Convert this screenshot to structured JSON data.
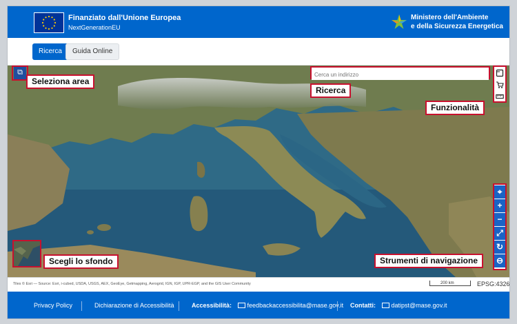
{
  "header": {
    "title": "Finanziato dall'Unione Europea",
    "subtitle": "NextGenerationEU",
    "ministry_line1": "Ministero dell'Ambiente",
    "ministry_line2": "e della Sicurezza Energetica"
  },
  "tabs": [
    {
      "label": "Ricerca",
      "active": true
    },
    {
      "label": "Guida Online",
      "active": false
    }
  ],
  "map": {
    "search_placeholder": "Cerca un indirizzo",
    "annotations": {
      "select_area": "Seleziona area",
      "search": "Ricerca",
      "functions": "Funzionalità",
      "background": "Scegli lo sfondo",
      "navigation": "Strumenti di navigazione"
    },
    "attribution": "Tiles © Esri — Source: Esri, i-cubed, USDA, USGS, AEX, GeoEye, Getmapping, Aerogrid, IGN, IGP, UPR-EGP, and the GIS User Community",
    "scale_label": "200 km",
    "projection": "EPSG:4326",
    "function_icons": [
      "layers-icon",
      "cart-icon",
      "ruler-icon"
    ],
    "nav_icons": [
      "locate-icon",
      "zoom-in-icon",
      "zoom-out-icon",
      "fullscreen-icon",
      "refresh-icon",
      "minus-circle-icon"
    ],
    "nav_glyphs": [
      "⌖",
      "+",
      "−",
      "⤢",
      "↻",
      "⊖"
    ]
  },
  "footer": {
    "privacy": "Privacy Policy",
    "accessibility_statement": "Dichiarazione di Accessibilità",
    "accessibility_label": "Accessibilità:",
    "accessibility_email": "feedbackaccessibilita@mase.gov.it",
    "contacts_label": "Contatti:",
    "contacts_email": "datipst@mase.gov.it"
  },
  "colors": {
    "primary": "#0066cc",
    "annotation_border": "#c8102e",
    "eu_blue": "#003399",
    "eu_star": "#ffcc00"
  }
}
